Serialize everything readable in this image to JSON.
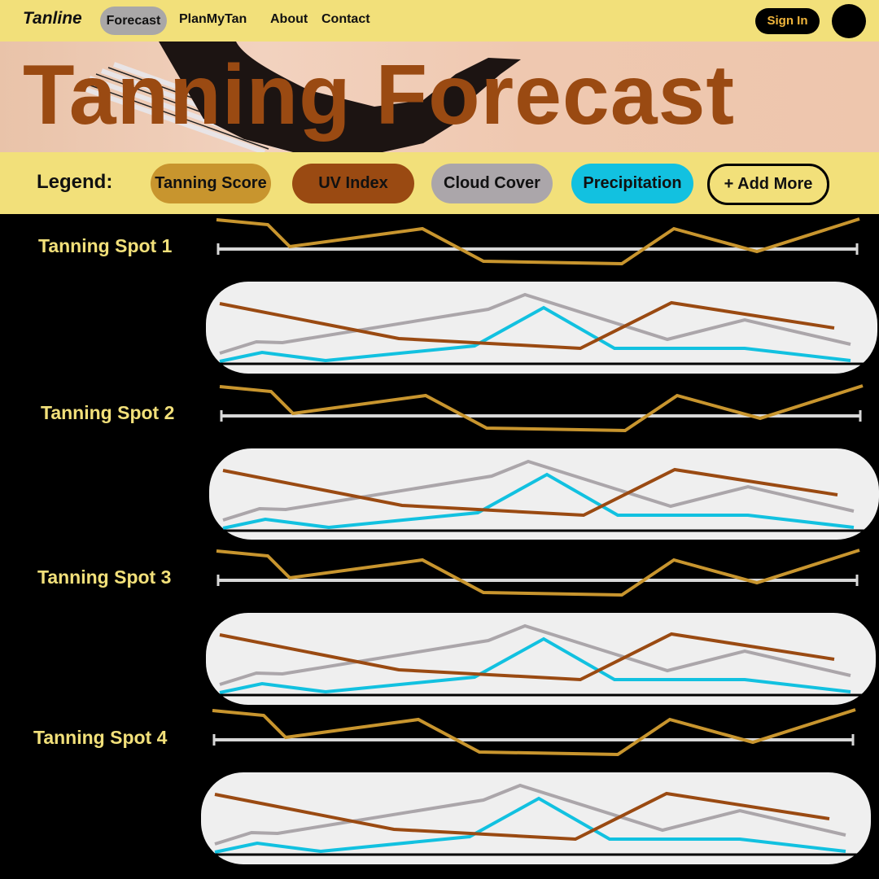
{
  "nav": {
    "brand": "Tanline",
    "links": [
      "Forecast",
      "PlanMyTan",
      "About",
      "Contact"
    ],
    "sign_in": "Sign In",
    "avatar_icon": "avatar-icon"
  },
  "hero": {
    "title": "Tanning Forecast"
  },
  "legend": {
    "label": "Legend:",
    "items": [
      {
        "label": "Tanning Score",
        "color": "#c8952e"
      },
      {
        "label": "UV Index",
        "color": "#9a4a12"
      },
      {
        "label": "Cloud Cover",
        "color": "#aba6aa"
      },
      {
        "label": "Precipitation",
        "color": "#12c1e0"
      }
    ],
    "add_more": "+ Add More"
  },
  "spots": [
    {
      "name": "Tanning Spot 1"
    },
    {
      "name": "Tanning Spot 2"
    },
    {
      "name": "Tanning Spot 3"
    },
    {
      "name": "Tanning Spot 4"
    }
  ],
  "chart_data": {
    "type": "line",
    "x": [
      0,
      1,
      2,
      3,
      4,
      5,
      6,
      7,
      8,
      9,
      10
    ],
    "series": [
      {
        "name": "Tanning Score",
        "color": "#c8952e",
        "values": [
          0.95,
          0.88,
          0.2,
          0.6,
          0.45,
          -0.38,
          -0.42,
          0.62,
          0.25,
          0.98
        ]
      },
      {
        "name": "UV Index",
        "color": "#9a4a12",
        "values": [
          0.74,
          0.3,
          0.24,
          0.2,
          0.76,
          0.6,
          0.55
        ]
      },
      {
        "name": "Cloud Cover",
        "color": "#aba6aa",
        "values": [
          0.1,
          0.25,
          0.26,
          0.66,
          0.91,
          0.8,
          0.34,
          0.6,
          0.24
        ]
      },
      {
        "name": "Precipitation",
        "color": "#12c1e0",
        "values": [
          0.02,
          0.1,
          0.04,
          0.2,
          0.77,
          0.2,
          0.2,
          0.02
        ]
      }
    ]
  }
}
